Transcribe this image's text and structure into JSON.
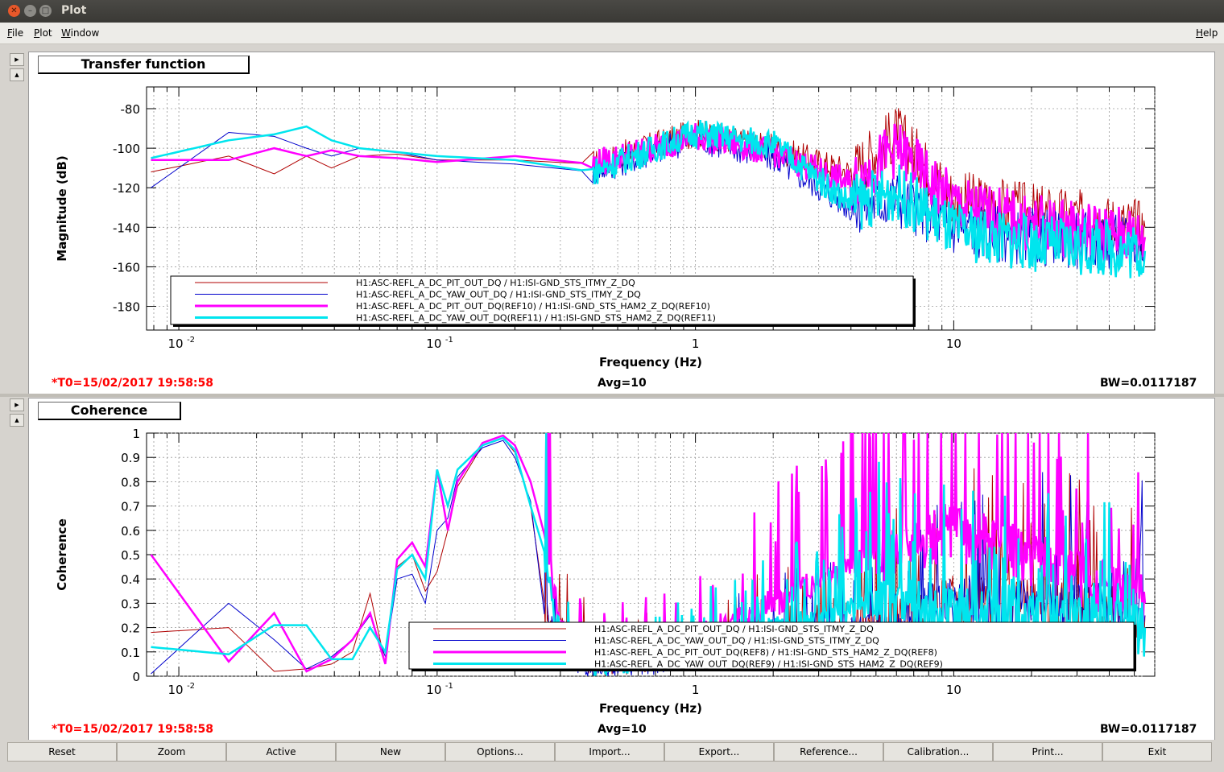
{
  "window": {
    "title": "Plot"
  },
  "menu": {
    "file": "File",
    "plot": "Plot",
    "window": "Window",
    "help": "Help"
  },
  "panels": [
    {
      "title": "Transfer function",
      "t0": "*T0=15/02/2017 19:58:58",
      "avg": "Avg=10",
      "bw": "BW=0.0117187"
    },
    {
      "title": "Coherence",
      "t0": "*T0=15/02/2017 19:58:58",
      "avg": "Avg=10",
      "bw": "BW=0.0117187"
    }
  ],
  "buttons": [
    "Reset",
    "Zoom",
    "Active",
    "New",
    "Options...",
    "Import...",
    "Export...",
    "Reference...",
    "Calibration...",
    "Print...",
    "Exit"
  ],
  "colors": {
    "red": "#ff0000",
    "darkred": "#b00000",
    "blue": "#0000cc",
    "magenta": "#ff00ff",
    "cyan": "#00e5ee"
  },
  "chart_data": [
    {
      "type": "line",
      "xscale": "log",
      "xlabel": "Frequency (Hz)",
      "ylabel": "Magnitude (dB)",
      "xlim": [
        0.0075,
        60
      ],
      "ylim": [
        -192,
        -69
      ],
      "yticks": [
        -80,
        -100,
        -120,
        -140,
        -160,
        -180
      ],
      "xticklabels": [
        "10^-2",
        "10^-1",
        "1",
        "10"
      ],
      "legend": [
        "H1:ASC-REFL_A_DC_PIT_OUT_DQ / H1:ISI-GND_STS_ITMY_Z_DQ",
        "H1:ASC-REFL_A_DC_YAW_OUT_DQ / H1:ISI-GND_STS_ITMY_Z_DQ",
        "H1:ASC-REFL_A_DC_PIT_OUT_DQ(REF10) / H1:ISI-GND_STS_HAM2_Z_DQ(REF10)",
        "H1:ASC-REFL_A_DC_YAW_OUT_DQ(REF11) / H1:ISI-GND_STS_HAM2_Z_DQ(REF11)"
      ],
      "series": [
        {
          "name": "H1:ASC-REFL_A_DC_PIT_OUT_DQ / H1:ISI-GND_STS_ITMY_Z_DQ",
          "x": [
            0.0078,
            0.0156,
            0.0234,
            0.0312,
            0.039,
            0.05,
            0.07,
            0.1,
            0.2,
            0.4,
            1,
            2,
            4,
            6,
            10,
            20,
            55
          ],
          "y": [
            -112,
            -104,
            -113,
            -104,
            -110,
            -104,
            -103,
            -106,
            -106,
            -108,
            -92,
            -100,
            -112,
            -92,
            -125,
            -132,
            -140
          ]
        },
        {
          "name": "H1:ASC-REFL_A_DC_YAW_OUT_DQ / H1:ISI-GND_STS_ITMY_Z_DQ",
          "x": [
            0.0078,
            0.0156,
            0.0234,
            0.0312,
            0.039,
            0.05,
            0.07,
            0.1,
            0.2,
            0.4,
            1,
            2,
            4,
            6,
            10,
            20,
            55
          ],
          "y": [
            -120,
            -92,
            -94,
            -100,
            -104,
            -100,
            -102,
            -106,
            -108,
            -112,
            -95,
            -105,
            -130,
            -125,
            -140,
            -145,
            -148
          ]
        },
        {
          "name": "H1:ASC-REFL_A_DC_PIT_OUT_DQ(REF10) / H1:ISI-GND_STS_HAM2_Z_DQ(REF10)",
          "x": [
            0.0078,
            0.0156,
            0.0234,
            0.0312,
            0.039,
            0.05,
            0.07,
            0.1,
            0.2,
            0.4,
            1,
            2,
            4,
            6,
            10,
            20,
            55
          ],
          "y": [
            -106,
            -106,
            -100,
            -104,
            -101,
            -104,
            -105,
            -107,
            -104,
            -108,
            -94,
            -102,
            -118,
            -100,
            -128,
            -138,
            -145
          ]
        },
        {
          "name": "H1:ASC-REFL_A_DC_YAW_OUT_DQ(REF11) / H1:ISI-GND_STS_HAM2_Z_DQ(REF11)",
          "x": [
            0.0078,
            0.0156,
            0.0234,
            0.0312,
            0.039,
            0.05,
            0.07,
            0.1,
            0.2,
            0.4,
            1,
            2,
            4,
            6,
            10,
            20,
            55
          ],
          "y": [
            -105,
            -96,
            -93,
            -89,
            -96,
            -100,
            -102,
            -104,
            -106,
            -112,
            -92,
            -98,
            -128,
            -122,
            -142,
            -148,
            -152
          ]
        }
      ]
    },
    {
      "type": "line",
      "xscale": "log",
      "xlabel": "Frequency (Hz)",
      "ylabel": "Coherence",
      "xlim": [
        0.0075,
        60
      ],
      "ylim": [
        0,
        1
      ],
      "yticks": [
        0,
        0.1,
        0.2,
        0.3,
        0.4,
        0.5,
        0.6,
        0.7,
        0.8,
        0.9,
        1
      ],
      "xticklabels": [
        "10^-2",
        "10^-1",
        "1",
        "10"
      ],
      "legend": [
        "H1:ASC-REFL_A_DC_PIT_OUT_DQ / H1:ISI-GND_STS_ITMY_Z_DQ",
        "H1:ASC-REFL_A_DC_YAW_OUT_DQ / H1:ISI-GND_STS_ITMY_Z_DQ",
        "H1:ASC-REFL_A_DC_PIT_OUT_DQ(REF8) / H1:ISI-GND_STS_HAM2_Z_DQ(REF8)",
        "H1:ASC-REFL_A_DC_YAW_OUT_DQ(REF9) / H1:ISI-GND_STS_HAM2_Z_DQ(REF9)"
      ],
      "series": [
        {
          "name": "H1:ASC-REFL_A_DC_PIT_OUT_DQ / H1:ISI-GND_STS_ITMY_Z_DQ",
          "x": [
            0.0078,
            0.0156,
            0.0234,
            0.0312,
            0.039,
            0.047,
            0.055,
            0.063,
            0.07,
            0.08,
            0.09,
            0.1,
            0.11,
            0.12,
            0.15,
            0.18,
            0.2,
            0.23,
            0.26,
            0.3,
            0.4,
            1,
            5,
            10,
            55
          ],
          "y": [
            0.18,
            0.2,
            0.02,
            0.03,
            0.05,
            0.1,
            0.34,
            0.05,
            0.45,
            0.5,
            0.35,
            0.43,
            0.6,
            0.78,
            0.95,
            0.98,
            0.92,
            0.7,
            0.25,
            0.2,
            0.05,
            0.1,
            0.2,
            0.3,
            0.25
          ]
        },
        {
          "name": "H1:ASC-REFL_A_DC_YAW_OUT_DQ / H1:ISI-GND_STS_ITMY_Z_DQ",
          "x": [
            0.0078,
            0.0156,
            0.0234,
            0.0312,
            0.039,
            0.047,
            0.055,
            0.063,
            0.07,
            0.08,
            0.09,
            0.1,
            0.11,
            0.12,
            0.15,
            0.18,
            0.2,
            0.23,
            0.26,
            0.3,
            0.4,
            1,
            5,
            10,
            55
          ],
          "y": [
            0.01,
            0.3,
            0.15,
            0.03,
            0.08,
            0.15,
            0.25,
            0.08,
            0.4,
            0.42,
            0.3,
            0.6,
            0.65,
            0.82,
            0.94,
            0.97,
            0.9,
            0.72,
            0.3,
            0.1,
            0.03,
            0.08,
            0.2,
            0.3,
            0.25
          ]
        },
        {
          "name": "H1:ASC-REFL_A_DC_PIT_OUT_DQ(REF8) / H1:ISI-GND_STS_HAM2_Z_DQ(REF8)",
          "x": [
            0.0078,
            0.0156,
            0.0234,
            0.0312,
            0.039,
            0.047,
            0.055,
            0.063,
            0.07,
            0.08,
            0.09,
            0.1,
            0.11,
            0.12,
            0.15,
            0.18,
            0.2,
            0.23,
            0.26,
            0.3,
            0.4,
            1,
            5,
            10,
            55
          ],
          "y": [
            0.5,
            0.06,
            0.26,
            0.02,
            0.07,
            0.15,
            0.26,
            0.05,
            0.48,
            0.55,
            0.45,
            0.85,
            0.6,
            0.8,
            0.96,
            0.99,
            0.95,
            0.8,
            0.6,
            0.2,
            0.05,
            0.15,
            0.5,
            0.6,
            0.3
          ]
        },
        {
          "name": "H1:ASC-REFL_A_DC_YAW_OUT_DQ(REF9) / H1:ISI-GND_STS_HAM2_Z_DQ(REF9)",
          "x": [
            0.0078,
            0.0156,
            0.0234,
            0.0312,
            0.039,
            0.047,
            0.055,
            0.063,
            0.07,
            0.08,
            0.09,
            0.1,
            0.11,
            0.12,
            0.15,
            0.18,
            0.2,
            0.23,
            0.26,
            0.3,
            0.4,
            1,
            5,
            10,
            55
          ],
          "y": [
            0.12,
            0.09,
            0.21,
            0.21,
            0.07,
            0.07,
            0.2,
            0.1,
            0.44,
            0.5,
            0.4,
            0.85,
            0.7,
            0.85,
            0.95,
            0.98,
            0.93,
            0.7,
            0.5,
            0.15,
            0.05,
            0.1,
            0.3,
            0.25,
            0.2
          ]
        }
      ]
    }
  ]
}
